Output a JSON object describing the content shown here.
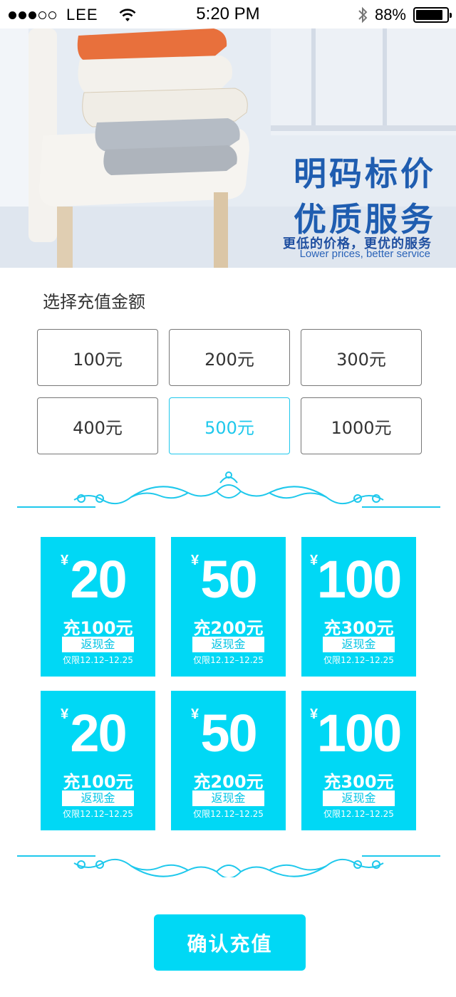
{
  "status_bar": {
    "carrier": "LEE",
    "time": "5:20 PM",
    "battery_text": "88%",
    "battery_level": 0.88,
    "signal_bars_filled": 3,
    "signal_bars_total": 5,
    "icons": [
      "wifi-icon",
      "bluetooth-icon",
      "battery-icon"
    ]
  },
  "banner": {
    "line1": "明码标价",
    "line2": "优质服务",
    "line3": "更低的价格，更优的服务",
    "line4": "Lower prices, better service"
  },
  "recharge": {
    "label": "选择充值金额",
    "options": [
      {
        "label": "100元",
        "selected": false
      },
      {
        "label": "200元",
        "selected": false
      },
      {
        "label": "300元",
        "selected": false
      },
      {
        "label": "400元",
        "selected": false
      },
      {
        "label": "500元",
        "selected": true
      },
      {
        "label": "1000元",
        "selected": false
      }
    ]
  },
  "coupons": [
    {
      "currency": "¥",
      "amount": "20",
      "desc": "充100元",
      "tag": "返现金",
      "limit": "仅限12.12–12.25"
    },
    {
      "currency": "¥",
      "amount": "50",
      "desc": "充200元",
      "tag": "返现金",
      "limit": "仅限12.12–12.25"
    },
    {
      "currency": "¥",
      "amount": "100",
      "desc": "充300元",
      "tag": "返现金",
      "limit": "仅限12.12–12.25"
    },
    {
      "currency": "¥",
      "amount": "20",
      "desc": "充100元",
      "tag": "返现金",
      "limit": "仅限12.12–12.25"
    },
    {
      "currency": "¥",
      "amount": "50",
      "desc": "充200元",
      "tag": "返现金",
      "limit": "仅限12.12–12.25"
    },
    {
      "currency": "¥",
      "amount": "100",
      "desc": "充300元",
      "tag": "返现金",
      "limit": "仅限12.12–12.25"
    }
  ],
  "confirm_label": "确认充值",
  "colors": {
    "accent": "#00d8f5",
    "accent_text": "#1ec8ec",
    "banner_text": "#1f5db0"
  }
}
